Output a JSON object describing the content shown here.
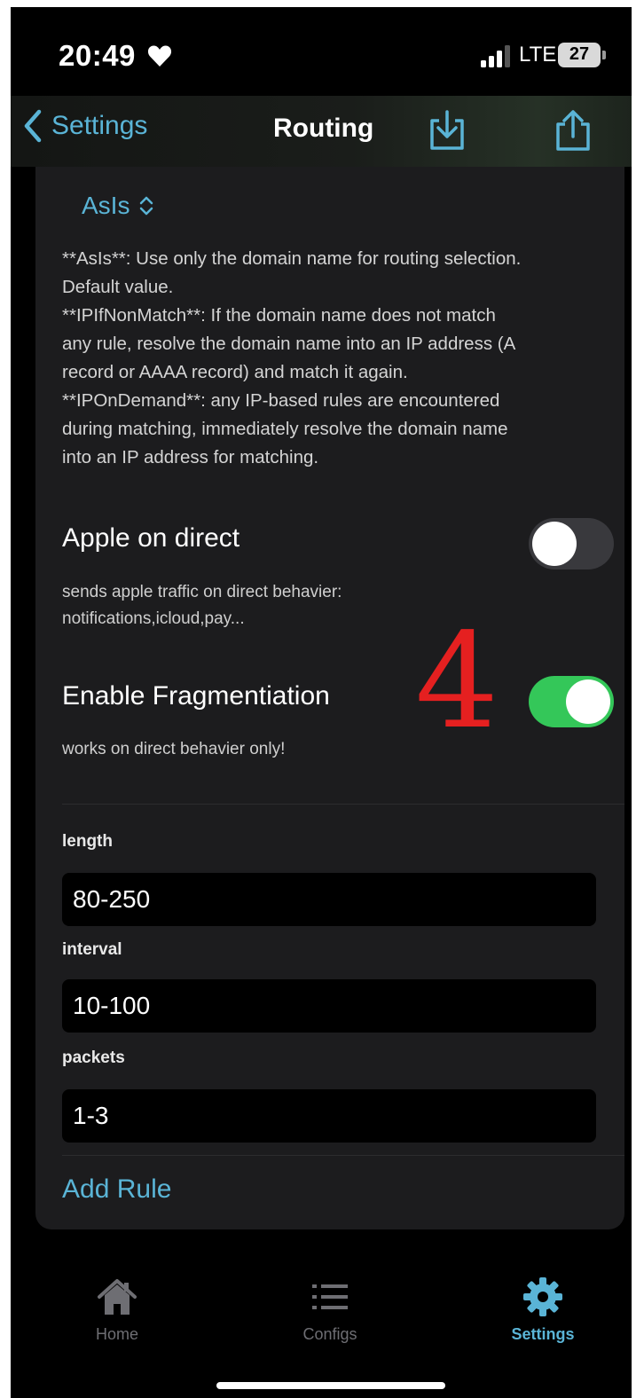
{
  "status_bar": {
    "time": "20:49",
    "network": "LTE",
    "battery": "27"
  },
  "nav": {
    "back_label": "Settings",
    "title": "Routing"
  },
  "domain_strategy": {
    "selected": "AsIs",
    "description_lines": [
      "**AsIs**: Use only the domain name for routing selection.",
      "Default value.",
      "**IPIfNonMatch**: If the domain name does not match",
      "any rule, resolve the domain name into an IP address (A",
      "record or AAAA record) and match it again.",
      "**IPOnDemand**: any IP-based rules are encountered",
      "during matching, immediately resolve the domain name",
      "into an IP address for matching."
    ]
  },
  "apple_on_direct": {
    "label": "Apple on direct",
    "subtitle_line1": "sends apple traffic on direct behavier:",
    "subtitle_line2": "notifications,icloud,pay...",
    "enabled": false
  },
  "annotation": "4",
  "fragmentation": {
    "label": "Enable Fragmentiation",
    "subtitle": "works on direct behavier only!",
    "enabled": true
  },
  "fields": {
    "length": {
      "label": "length",
      "value": "80-250"
    },
    "interval": {
      "label": "interval",
      "value": "10-100"
    },
    "packets": {
      "label": "packets",
      "value": "1-3"
    }
  },
  "add_rule_label": "Add Rule",
  "tabs": [
    {
      "label": "Home",
      "icon": "house-icon",
      "active": false
    },
    {
      "label": "Configs",
      "icon": "list-icon",
      "active": false
    },
    {
      "label": "Settings",
      "icon": "gear-icon",
      "active": true
    }
  ],
  "colors": {
    "accent": "#5ab4d6",
    "toggle_on": "#34c759",
    "toggle_off": "#39393d",
    "card_bg": "#1c1c1e",
    "annotation": "#e52020"
  }
}
